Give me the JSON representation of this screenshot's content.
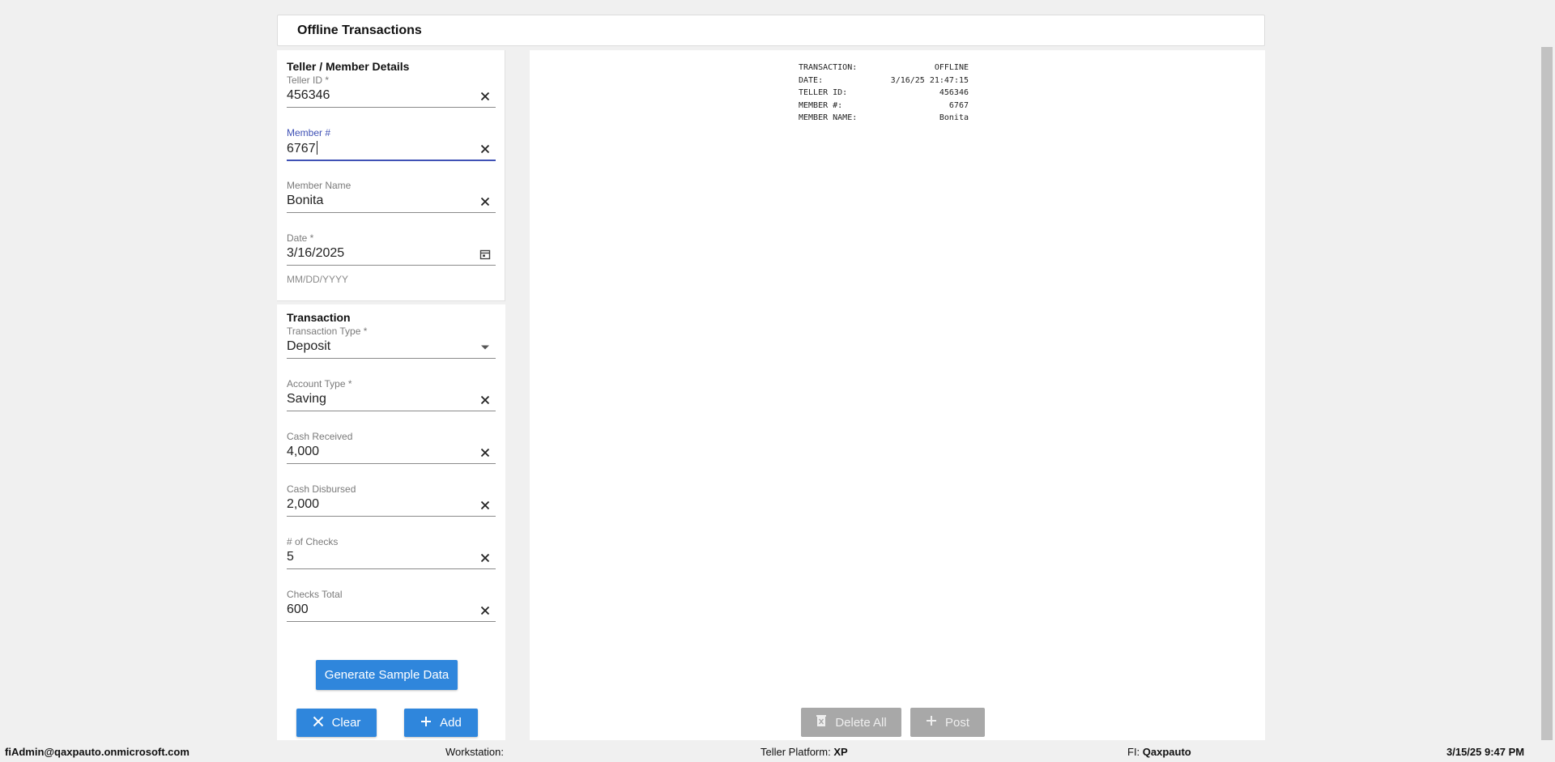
{
  "header": {
    "title": "Offline Transactions"
  },
  "details": {
    "title": "Teller / Member Details",
    "teller_id": {
      "label": "Teller ID *",
      "value": "456346"
    },
    "member_no": {
      "label": "Member #",
      "value": "6767"
    },
    "member_name": {
      "label": "Member Name",
      "value": "Bonita"
    },
    "date": {
      "label": "Date *",
      "value": "3/16/2025",
      "helper": "MM/DD/YYYY"
    }
  },
  "transaction": {
    "title": "Transaction",
    "type": {
      "label": "Transaction Type *",
      "value": "Deposit"
    },
    "account_type": {
      "label": "Account Type *",
      "value": "Saving"
    },
    "cash_received": {
      "label": "Cash Received",
      "value": "4,000"
    },
    "cash_disbursed": {
      "label": "Cash Disbursed",
      "value": "2,000"
    },
    "num_checks": {
      "label": "# of Checks",
      "value": "5"
    },
    "checks_total": {
      "label": "Checks Total",
      "value": "600"
    }
  },
  "buttons": {
    "generate": "Generate Sample Data",
    "clear": "Clear",
    "add": "Add",
    "delete_all": "Delete All",
    "post": "Post"
  },
  "receipt": {
    "rows": [
      {
        "k": "TRANSACTION:",
        "v": "OFFLINE"
      },
      {
        "k": "DATE:",
        "v": "3/16/25 21:47:15"
      },
      {
        "k": "TELLER ID:",
        "v": "456346"
      },
      {
        "k": "MEMBER #:",
        "v": "6767"
      },
      {
        "k": "MEMBER NAME:",
        "v": "Bonita"
      }
    ]
  },
  "footer": {
    "user": "fiAdmin@qaxpauto.onmicrosoft.com",
    "workstation_label": "Workstation:",
    "platform_label": "Teller Platform:",
    "platform_value": "XP",
    "fi_label": "FI:",
    "fi_value": "Qaxpauto",
    "datetime": "3/15/25 9:47 PM"
  },
  "colors": {
    "primary": "#2f86dc",
    "focus": "#3f51b5",
    "disabled": "#a8a8a8"
  },
  "icons": [
    "close-icon",
    "calendar-icon",
    "dropdown-arrow-icon",
    "plus-icon",
    "trash-icon"
  ]
}
